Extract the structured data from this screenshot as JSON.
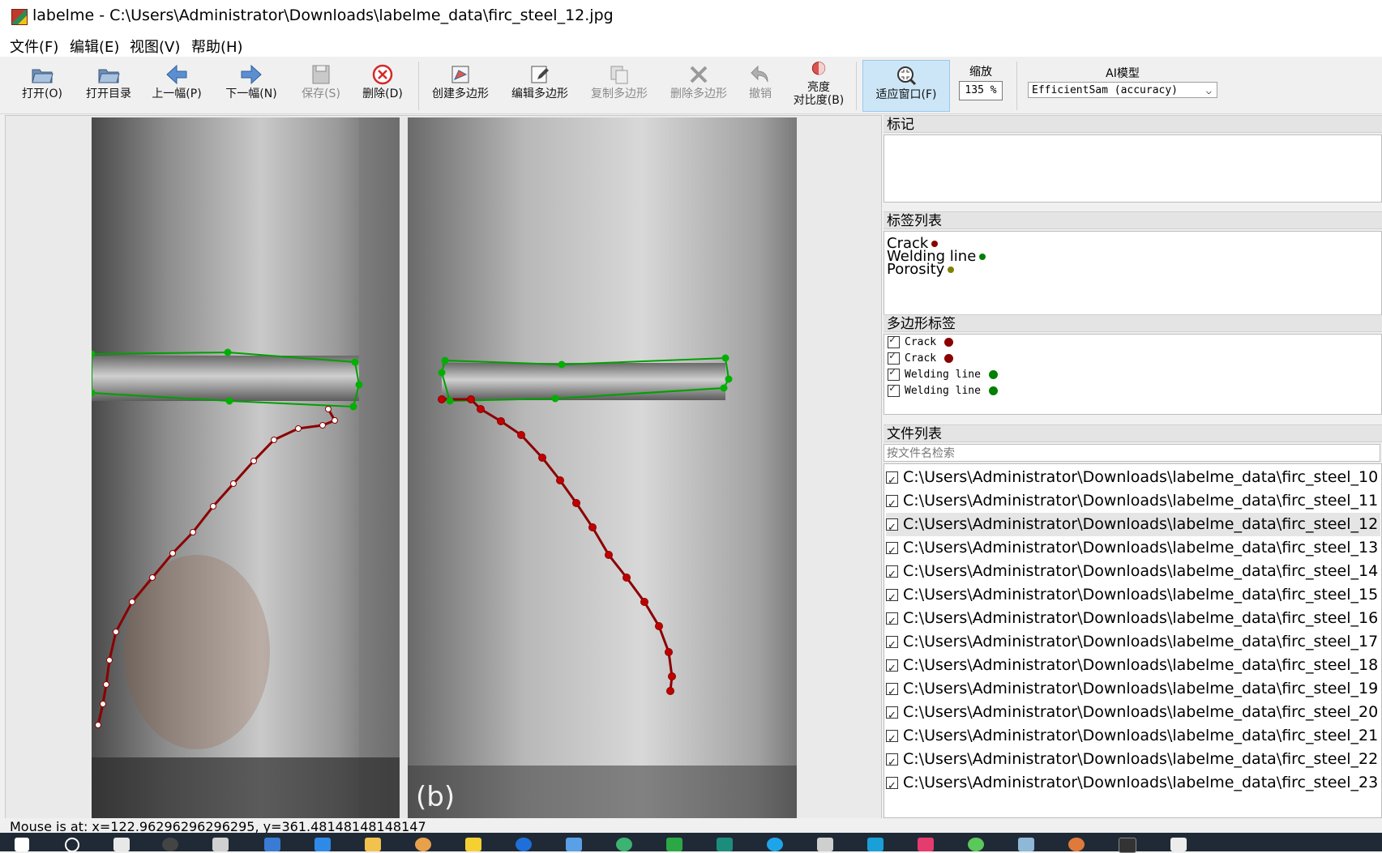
{
  "window": {
    "title": "labelme - C:\\Users\\Administrator\\Downloads\\labelme_data\\firc_steel_12.jpg"
  },
  "menu": [
    "文件(F)",
    "编辑(E)",
    "视图(V)",
    "帮助(H)"
  ],
  "toolbar": {
    "open": "打开(O)",
    "open_dir": "打开目录",
    "prev": "上一幅(P)",
    "next": "下一幅(N)",
    "save": "保存(S)",
    "delete": "删除(D)",
    "create_polygon": "创建多边形",
    "edit_polygon": "编辑多边形",
    "copy_polygon": "复制多边形",
    "delete_polygon": "删除多边形",
    "undo": "撤销",
    "brightness_line1": "亮度",
    "brightness_line2": "对比度(B)",
    "fit_window": "适应窗口(F)",
    "zoom_label": "缩放",
    "zoom_value": "135 %",
    "ai_label": "AI模型",
    "ai_model": "EfficientSam (accuracy)"
  },
  "image_caption": "(b)",
  "dock": {
    "flags_title": "标记",
    "labels_title": "标签列表",
    "labels": [
      {
        "name": "Crack",
        "color": "#8b0000"
      },
      {
        "name": "Welding line",
        "color": "#008000"
      },
      {
        "name": "Porosity",
        "color": "#808000"
      }
    ],
    "polygons_title": "多边形标签",
    "polygons": [
      {
        "name": "Crack",
        "color": "#8b0000"
      },
      {
        "name": "Crack",
        "color": "#8b0000"
      },
      {
        "name": "Welding line",
        "color": "#008000"
      },
      {
        "name": "Welding line",
        "color": "#008000"
      }
    ],
    "files_title": "文件列表",
    "search_placeholder": "按文件名检索",
    "files": [
      "C:\\Users\\Administrator\\Downloads\\labelme_data\\firc_steel_10",
      "C:\\Users\\Administrator\\Downloads\\labelme_data\\firc_steel_11",
      "C:\\Users\\Administrator\\Downloads\\labelme_data\\firc_steel_12",
      "C:\\Users\\Administrator\\Downloads\\labelme_data\\firc_steel_13",
      "C:\\Users\\Administrator\\Downloads\\labelme_data\\firc_steel_14",
      "C:\\Users\\Administrator\\Downloads\\labelme_data\\firc_steel_15",
      "C:\\Users\\Administrator\\Downloads\\labelme_data\\firc_steel_16",
      "C:\\Users\\Administrator\\Downloads\\labelme_data\\firc_steel_17",
      "C:\\Users\\Administrator\\Downloads\\labelme_data\\firc_steel_18",
      "C:\\Users\\Administrator\\Downloads\\labelme_data\\firc_steel_19",
      "C:\\Users\\Administrator\\Downloads\\labelme_data\\firc_steel_20",
      "C:\\Users\\Administrator\\Downloads\\labelme_data\\firc_steel_21",
      "C:\\Users\\Administrator\\Downloads\\labelme_data\\firc_steel_22",
      "C:\\Users\\Administrator\\Downloads\\labelme_data\\firc_steel_23"
    ],
    "selected_file_index": 2
  },
  "status": "Mouse is at: x=122.96296296296295, y=361.48148148148147",
  "colors": {
    "crack": "#8b0000",
    "welding_line": "#008000",
    "selection": "#cde6f7"
  }
}
